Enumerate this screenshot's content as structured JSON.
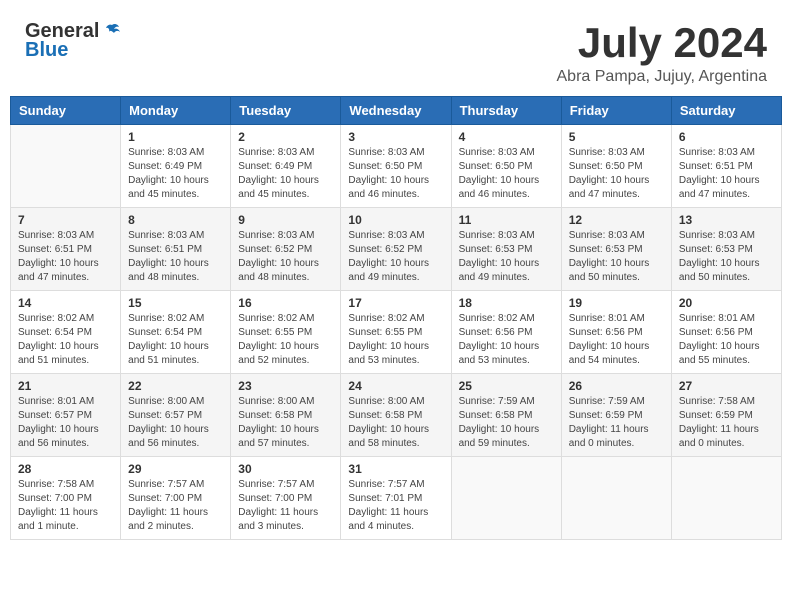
{
  "header": {
    "logo_line1": "General",
    "logo_line2": "Blue",
    "main_title": "July 2024",
    "subtitle": "Abra Pampa, Jujuy, Argentina"
  },
  "days_of_week": [
    "Sunday",
    "Monday",
    "Tuesday",
    "Wednesday",
    "Thursday",
    "Friday",
    "Saturday"
  ],
  "weeks": [
    [
      {
        "day": "",
        "sunrise": "",
        "sunset": "",
        "daylight": ""
      },
      {
        "day": "1",
        "sunrise": "Sunrise: 8:03 AM",
        "sunset": "Sunset: 6:49 PM",
        "daylight": "Daylight: 10 hours and 45 minutes."
      },
      {
        "day": "2",
        "sunrise": "Sunrise: 8:03 AM",
        "sunset": "Sunset: 6:49 PM",
        "daylight": "Daylight: 10 hours and 45 minutes."
      },
      {
        "day": "3",
        "sunrise": "Sunrise: 8:03 AM",
        "sunset": "Sunset: 6:50 PM",
        "daylight": "Daylight: 10 hours and 46 minutes."
      },
      {
        "day": "4",
        "sunrise": "Sunrise: 8:03 AM",
        "sunset": "Sunset: 6:50 PM",
        "daylight": "Daylight: 10 hours and 46 minutes."
      },
      {
        "day": "5",
        "sunrise": "Sunrise: 8:03 AM",
        "sunset": "Sunset: 6:50 PM",
        "daylight": "Daylight: 10 hours and 47 minutes."
      },
      {
        "day": "6",
        "sunrise": "Sunrise: 8:03 AM",
        "sunset": "Sunset: 6:51 PM",
        "daylight": "Daylight: 10 hours and 47 minutes."
      }
    ],
    [
      {
        "day": "7",
        "sunrise": "Sunrise: 8:03 AM",
        "sunset": "Sunset: 6:51 PM",
        "daylight": "Daylight: 10 hours and 47 minutes."
      },
      {
        "day": "8",
        "sunrise": "Sunrise: 8:03 AM",
        "sunset": "Sunset: 6:51 PM",
        "daylight": "Daylight: 10 hours and 48 minutes."
      },
      {
        "day": "9",
        "sunrise": "Sunrise: 8:03 AM",
        "sunset": "Sunset: 6:52 PM",
        "daylight": "Daylight: 10 hours and 48 minutes."
      },
      {
        "day": "10",
        "sunrise": "Sunrise: 8:03 AM",
        "sunset": "Sunset: 6:52 PM",
        "daylight": "Daylight: 10 hours and 49 minutes."
      },
      {
        "day": "11",
        "sunrise": "Sunrise: 8:03 AM",
        "sunset": "Sunset: 6:53 PM",
        "daylight": "Daylight: 10 hours and 49 minutes."
      },
      {
        "day": "12",
        "sunrise": "Sunrise: 8:03 AM",
        "sunset": "Sunset: 6:53 PM",
        "daylight": "Daylight: 10 hours and 50 minutes."
      },
      {
        "day": "13",
        "sunrise": "Sunrise: 8:03 AM",
        "sunset": "Sunset: 6:53 PM",
        "daylight": "Daylight: 10 hours and 50 minutes."
      }
    ],
    [
      {
        "day": "14",
        "sunrise": "Sunrise: 8:02 AM",
        "sunset": "Sunset: 6:54 PM",
        "daylight": "Daylight: 10 hours and 51 minutes."
      },
      {
        "day": "15",
        "sunrise": "Sunrise: 8:02 AM",
        "sunset": "Sunset: 6:54 PM",
        "daylight": "Daylight: 10 hours and 51 minutes."
      },
      {
        "day": "16",
        "sunrise": "Sunrise: 8:02 AM",
        "sunset": "Sunset: 6:55 PM",
        "daylight": "Daylight: 10 hours and 52 minutes."
      },
      {
        "day": "17",
        "sunrise": "Sunrise: 8:02 AM",
        "sunset": "Sunset: 6:55 PM",
        "daylight": "Daylight: 10 hours and 53 minutes."
      },
      {
        "day": "18",
        "sunrise": "Sunrise: 8:02 AM",
        "sunset": "Sunset: 6:56 PM",
        "daylight": "Daylight: 10 hours and 53 minutes."
      },
      {
        "day": "19",
        "sunrise": "Sunrise: 8:01 AM",
        "sunset": "Sunset: 6:56 PM",
        "daylight": "Daylight: 10 hours and 54 minutes."
      },
      {
        "day": "20",
        "sunrise": "Sunrise: 8:01 AM",
        "sunset": "Sunset: 6:56 PM",
        "daylight": "Daylight: 10 hours and 55 minutes."
      }
    ],
    [
      {
        "day": "21",
        "sunrise": "Sunrise: 8:01 AM",
        "sunset": "Sunset: 6:57 PM",
        "daylight": "Daylight: 10 hours and 56 minutes."
      },
      {
        "day": "22",
        "sunrise": "Sunrise: 8:00 AM",
        "sunset": "Sunset: 6:57 PM",
        "daylight": "Daylight: 10 hours and 56 minutes."
      },
      {
        "day": "23",
        "sunrise": "Sunrise: 8:00 AM",
        "sunset": "Sunset: 6:58 PM",
        "daylight": "Daylight: 10 hours and 57 minutes."
      },
      {
        "day": "24",
        "sunrise": "Sunrise: 8:00 AM",
        "sunset": "Sunset: 6:58 PM",
        "daylight": "Daylight: 10 hours and 58 minutes."
      },
      {
        "day": "25",
        "sunrise": "Sunrise: 7:59 AM",
        "sunset": "Sunset: 6:58 PM",
        "daylight": "Daylight: 10 hours and 59 minutes."
      },
      {
        "day": "26",
        "sunrise": "Sunrise: 7:59 AM",
        "sunset": "Sunset: 6:59 PM",
        "daylight": "Daylight: 11 hours and 0 minutes."
      },
      {
        "day": "27",
        "sunrise": "Sunrise: 7:58 AM",
        "sunset": "Sunset: 6:59 PM",
        "daylight": "Daylight: 11 hours and 0 minutes."
      }
    ],
    [
      {
        "day": "28",
        "sunrise": "Sunrise: 7:58 AM",
        "sunset": "Sunset: 7:00 PM",
        "daylight": "Daylight: 11 hours and 1 minute."
      },
      {
        "day": "29",
        "sunrise": "Sunrise: 7:57 AM",
        "sunset": "Sunset: 7:00 PM",
        "daylight": "Daylight: 11 hours and 2 minutes."
      },
      {
        "day": "30",
        "sunrise": "Sunrise: 7:57 AM",
        "sunset": "Sunset: 7:00 PM",
        "daylight": "Daylight: 11 hours and 3 minutes."
      },
      {
        "day": "31",
        "sunrise": "Sunrise: 7:57 AM",
        "sunset": "Sunset: 7:01 PM",
        "daylight": "Daylight: 11 hours and 4 minutes."
      },
      {
        "day": "",
        "sunrise": "",
        "sunset": "",
        "daylight": ""
      },
      {
        "day": "",
        "sunrise": "",
        "sunset": "",
        "daylight": ""
      },
      {
        "day": "",
        "sunrise": "",
        "sunset": "",
        "daylight": ""
      }
    ]
  ]
}
